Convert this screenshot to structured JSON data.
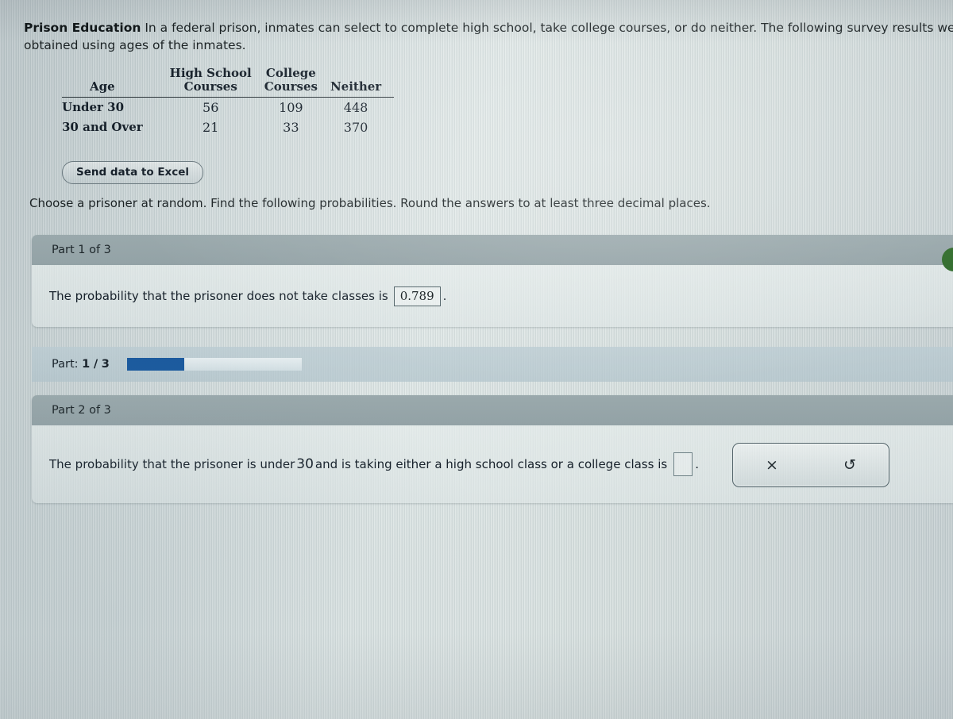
{
  "problem": {
    "title": "Prison Education",
    "intro_line1_rest": " In a federal prison, inmates can select to complete high school, take college courses, or do neither. The following survey results were",
    "intro_line2": "obtained using ages of the inmates.",
    "instruction": "Choose a prisoner at random. Find the following probabilities. Round the answers to at least three decimal places."
  },
  "table": {
    "headers": {
      "age": "Age",
      "high_school_l1": "High School",
      "high_school_l2": "Courses",
      "college_l1": "College",
      "college_l2": "Courses",
      "neither": "Neither"
    },
    "rows": [
      {
        "label": "Under 30",
        "high_school": "56",
        "college": "109",
        "neither": "448"
      },
      {
        "label": "30 and Over",
        "high_school": "21",
        "college": "33",
        "neither": "370"
      }
    ]
  },
  "excel_button": {
    "label": "Send data to Excel"
  },
  "part1": {
    "header": "Part 1 of 3",
    "question_prefix": "The probability that the prisoner does not take classes is",
    "answer_value": "0.789",
    "period": "."
  },
  "progress": {
    "label_prefix": "Part:",
    "current": "1",
    "separator": "/",
    "total": "3",
    "percent": 33,
    "fill_color": "#1b5a9e"
  },
  "part2": {
    "header": "Part 2 of 3",
    "question_prefix": "The probability that the prisoner is under",
    "inline_number": "30",
    "question_suffix": "and is taking either a high school class or a college class is",
    "answer_value": "",
    "period": "."
  },
  "tools": {
    "clear_icon": "×",
    "undo_icon": "↺"
  },
  "status": {
    "correct_badge": "correct-check-badge",
    "badge_color": "#2f6b2a"
  }
}
